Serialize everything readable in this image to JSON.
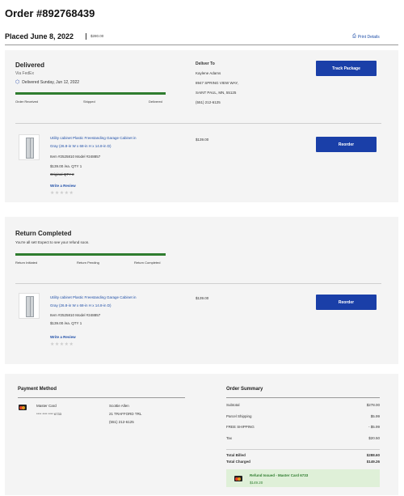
{
  "header": {
    "order_title": "Order #892768439",
    "placed": "Placed June 8, 2022",
    "placed_total": "$280.00",
    "print_label": "Print Details"
  },
  "shipment": {
    "status": "Delivered",
    "via": "Via FedEx",
    "delivered_on": "Delivered Sunday, Jun 12, 2022",
    "progress_fraction": 1.0,
    "steps": [
      "Order Received",
      "Shipped",
      "Delivered"
    ],
    "deliver_to_label": "Deliver To",
    "address": [
      "Kaylene Adams",
      "8947 SPRING VIEW WAY,",
      "SAINT PAUL, MN, 55125",
      "(551) 212-6125"
    ],
    "track_label": "Track Package"
  },
  "item1": {
    "name_line1": "Utility cabinet Plastic Freestanding Garage Cabinet in",
    "name_line2": "Gray (26.8-in W x 68-in H x 14.8-in D)",
    "item_no": "Item #2525810 Model #248857",
    "price_qty": "$139.00 /ea. QTY 1",
    "original_qty": "Original QTY 2",
    "review_label": "Write a Review",
    "stars": "★★★★★",
    "line_total": "$139.00",
    "reorder_label": "Reorder"
  },
  "return": {
    "status": "Return Completed",
    "message": "You're all set! Expect to see your refund soon.",
    "progress_fraction": 1.0,
    "steps": [
      "Return Initiated",
      "Return Pending",
      "Return Completed"
    ]
  },
  "item2": {
    "name_line1": "Utility cabinet Plastic Freestanding Garage Cabinet in",
    "name_line2": "Gray (26.8-in W x 68-in H x 14.8-in D)",
    "item_no": "Item #2525810 Model #248857",
    "price_qty": "$139.00 /ea. QTY 1",
    "review_label": "Write a Review",
    "stars": "★★★★★",
    "line_total": "$139.00",
    "reorder_label": "Reorder"
  },
  "payment": {
    "title": "Payment Method",
    "card_name": "Master Card",
    "card_number": "**** **** **** 6733",
    "billing": [
      "Scottie Allen",
      "21 TRAFFORD TRL",
      "(551) 212-6125"
    ]
  },
  "summary": {
    "title": "Order Summary",
    "rows": [
      {
        "label": "Subtotal",
        "value": "$278.00"
      },
      {
        "label": "Parcel Shipping",
        "value": "$5.99"
      },
      {
        "label": "FREE SHIPPING",
        "value": "- $5.99"
      },
      {
        "label": "Tax",
        "value": "$20.50"
      }
    ],
    "total_billed_label": "Total Billed",
    "total_billed": "$288.60",
    "total_charged_label": "Total Charged",
    "total_charged": "$149.26",
    "refund_label": "Refund Issued - Master Card 6733",
    "refund_amount": "$149.20"
  },
  "colors": {
    "accent": "#1a3fa8",
    "progress": "#2f7d2f",
    "refund_bg": "#dff0d8"
  },
  "icons": [
    "printer-icon",
    "box-icon",
    "mastercard-icon",
    "cabinet-image"
  ]
}
